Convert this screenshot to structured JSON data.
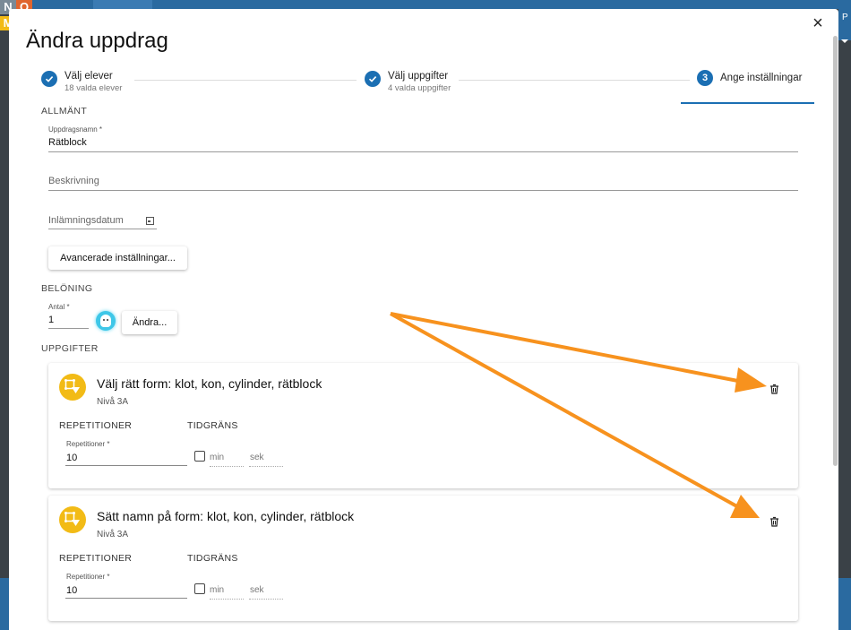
{
  "background": {
    "logo_letters": [
      "N",
      "O",
      "M",
      ""
    ],
    "right_text": "P"
  },
  "dialog": {
    "title": "Ändra uppdrag",
    "close_label": "×"
  },
  "stepper": {
    "steps": [
      {
        "label": "Välj elever",
        "sub": "18 valda elever",
        "icon": "check-icon"
      },
      {
        "label": "Välj uppgifter",
        "sub": "4 valda uppgifter",
        "icon": "check-icon"
      },
      {
        "label": "Ange inställningar",
        "number": "3"
      }
    ]
  },
  "general": {
    "heading": "ALLMÄNT",
    "name_label": "Uppdragsnamn *",
    "name_value": "Rätblock",
    "description_placeholder": "Beskrivning",
    "due_date_placeholder": "Inlämningsdatum",
    "advanced_button": "Avancerade inställningar..."
  },
  "reward": {
    "heading": "BELÖNING",
    "count_label": "Antal *",
    "count_value": "1",
    "change_button": "Ändra..."
  },
  "tasks": {
    "heading": "UPPGIFTER",
    "items": [
      {
        "title": "Välj rätt form: klot, kon, cylinder, rätblock",
        "level": "Nivå 3A",
        "repetitions_heading": "REPETITIONER",
        "time_limit_heading": "TIDGRÄNS",
        "repetitions_label": "Repetitioner *",
        "repetitions_value": "10",
        "min_placeholder": "min",
        "sec_placeholder": "sek"
      },
      {
        "title": "Sätt namn på form: klot, kon, cylinder, rätblock",
        "level": "Nivå 3A",
        "repetitions_heading": "REPETITIONER",
        "time_limit_heading": "TIDGRÄNS",
        "repetitions_label": "Repetitioner *",
        "repetitions_value": "10",
        "min_placeholder": "min",
        "sec_placeholder": "sek"
      }
    ]
  },
  "colors": {
    "primary": "#1b6fb3",
    "task_badge": "#f2bb16",
    "annotation_arrow": "#f7921e",
    "avatar": "#3ec7e8"
  }
}
